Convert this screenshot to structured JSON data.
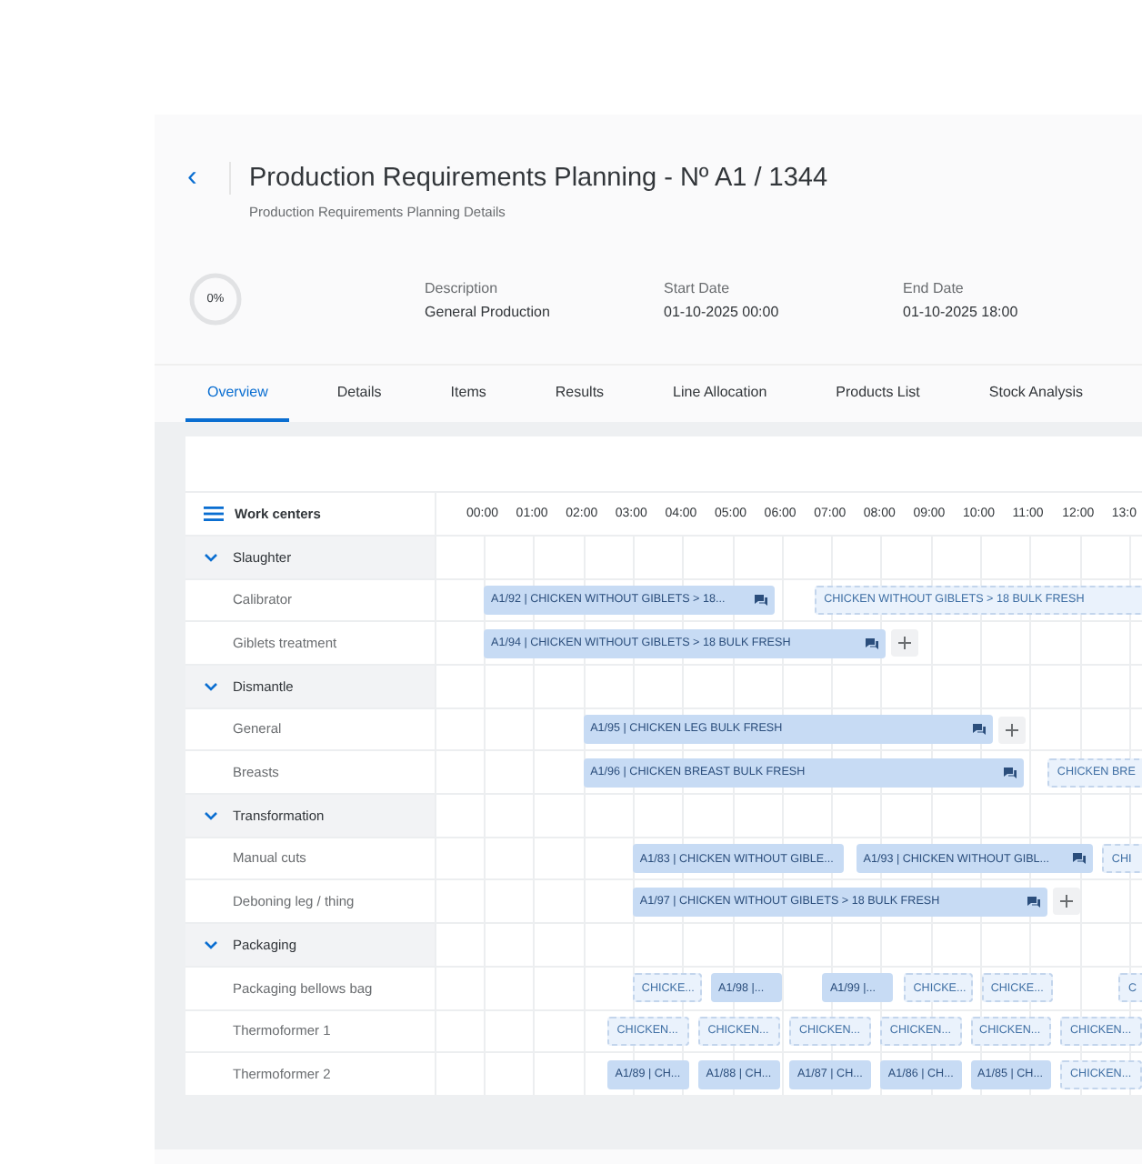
{
  "header": {
    "back": "‹",
    "title": "Production Requirements Planning - Nº A1 / 1344",
    "subtitle": "Production Requirements Planning Details"
  },
  "progress": {
    "label": "0%"
  },
  "fields": [
    {
      "label": "Description",
      "value": "General Production"
    },
    {
      "label": "Start Date",
      "value": "01-10-2025 00:00"
    },
    {
      "label": "End Date",
      "value": "01-10-2025 18:00"
    }
  ],
  "tabs": [
    {
      "label": "Overview",
      "selected": true
    },
    {
      "label": "Details",
      "selected": false
    },
    {
      "label": "Items",
      "selected": false
    },
    {
      "label": "Results",
      "selected": false
    },
    {
      "label": "Line Allocation",
      "selected": false
    },
    {
      "label": "Products List",
      "selected": false
    },
    {
      "label": "Stock Analysis",
      "selected": false
    }
  ],
  "gantt": {
    "header": "Work centers",
    "hours": [
      "00:00",
      "01:00",
      "02:00",
      "03:00",
      "04:00",
      "05:00",
      "06:00",
      "07:00",
      "08:00",
      "09:00",
      "10:00",
      "11:00",
      "12:00",
      "13:0"
    ],
    "groups": [
      {
        "name": "Slaughter",
        "expanded": true,
        "children": [
          {
            "name": "Calibrator",
            "bars": [
              {
                "kind": "planned",
                "label": "A1/92 | CHICKEN WITHOUT GIBLETS > 18...",
                "comment": true,
                "add": false
              },
              {
                "kind": "suggested",
                "label": "CHICKEN WITHOUT GIBLETS > 18 BULK FRESH",
                "comment": false,
                "add": false
              }
            ]
          },
          {
            "name": "Giblets treatment",
            "bars": [
              {
                "kind": "planned",
                "label": "A1/94 | CHICKEN WITHOUT GIBLETS > 18 BULK FRESH",
                "comment": true,
                "add": true
              }
            ]
          }
        ]
      },
      {
        "name": "Dismantle",
        "expanded": true,
        "children": [
          {
            "name": "General",
            "bars": [
              {
                "kind": "planned",
                "label": "A1/95 | CHICKEN LEG BULK FRESH",
                "comment": true,
                "add": true
              }
            ]
          },
          {
            "name": "Breasts",
            "bars": [
              {
                "kind": "planned",
                "label": "A1/96 | CHICKEN BREAST BULK FRESH",
                "comment": true,
                "add": false
              },
              {
                "kind": "suggested",
                "label": "CHICKEN BRE",
                "comment": false,
                "add": false
              }
            ]
          }
        ]
      },
      {
        "name": "Transformation",
        "expanded": true,
        "children": [
          {
            "name": "Manual cuts",
            "bars": [
              {
                "kind": "planned",
                "label": "A1/83 | CHICKEN WITHOUT GIBLE...",
                "comment": false,
                "add": false
              },
              {
                "kind": "planned",
                "label": "A1/93 | CHICKEN WITHOUT GIBL...",
                "comment": true,
                "add": false
              },
              {
                "kind": "suggested",
                "label": "CHI",
                "comment": false,
                "add": false
              }
            ]
          },
          {
            "name": "Deboning leg / thing",
            "bars": [
              {
                "kind": "planned",
                "label": "A1/97 | CHICKEN WITHOUT GIBLETS > 18 BULK FRESH",
                "comment": true,
                "add": true
              }
            ]
          }
        ]
      },
      {
        "name": "Packaging",
        "expanded": true,
        "children": [
          {
            "name": "Packaging bellows bag",
            "bars": [
              {
                "kind": "suggested",
                "label": "CHICKE...",
                "comment": false,
                "add": false
              },
              {
                "kind": "planned",
                "label": "A1/98 |...",
                "comment": false,
                "add": false
              },
              {
                "kind": "planned",
                "label": "A1/99 |...",
                "comment": false,
                "add": false
              },
              {
                "kind": "suggested",
                "label": "CHICKE...",
                "comment": false,
                "add": false
              },
              {
                "kind": "suggested",
                "label": "CHICKE...",
                "comment": false,
                "add": false
              },
              {
                "kind": "suggested",
                "label": "C",
                "comment": false,
                "add": false
              }
            ]
          },
          {
            "name": "Thermoformer 1",
            "bars": [
              {
                "kind": "suggested",
                "label": "CHICKEN...",
                "comment": false,
                "add": false
              },
              {
                "kind": "suggested",
                "label": "CHICKEN...",
                "comment": false,
                "add": false
              },
              {
                "kind": "suggested",
                "label": "CHICKEN...",
                "comment": false,
                "add": false
              },
              {
                "kind": "suggested",
                "label": "CHICKEN...",
                "comment": false,
                "add": false
              },
              {
                "kind": "suggested",
                "label": "CHICKEN...",
                "comment": false,
                "add": false
              },
              {
                "kind": "suggested",
                "label": "CHICKEN...",
                "comment": false,
                "add": false
              }
            ]
          },
          {
            "name": "Thermoformer 2",
            "bars": [
              {
                "kind": "planned",
                "label": "A1/89 | CH...",
                "comment": false,
                "add": false
              },
              {
                "kind": "planned",
                "label": "A1/88 | CH...",
                "comment": false,
                "add": false
              },
              {
                "kind": "planned",
                "label": "A1/87 | CH...",
                "comment": false,
                "add": false
              },
              {
                "kind": "planned",
                "label": "A1/86 | CH...",
                "comment": false,
                "add": false
              },
              {
                "kind": "planned",
                "label": "A1/85 | CH...",
                "comment": false,
                "add": false
              },
              {
                "kind": "suggested",
                "label": "CHICKEN...",
                "comment": false,
                "add": false
              }
            ]
          }
        ]
      }
    ]
  }
}
